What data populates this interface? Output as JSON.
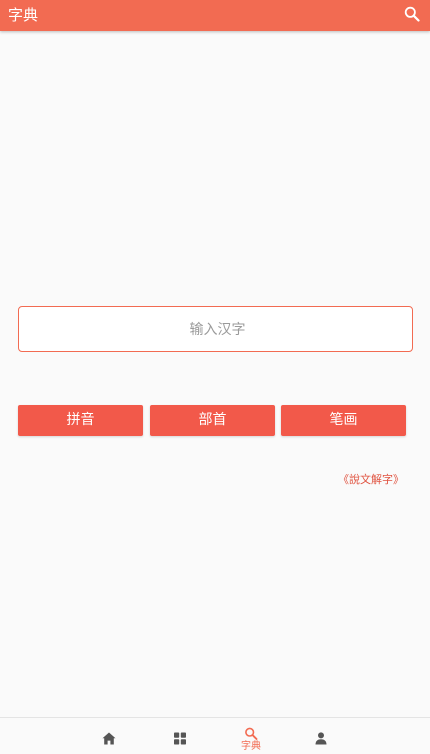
{
  "header": {
    "title": "字典",
    "search_icon": "search-icon"
  },
  "search": {
    "placeholder": "输入汉字",
    "value": ""
  },
  "buttons": {
    "pinyin": "拼音",
    "bushou": "部首",
    "bihua": "笔画"
  },
  "links": {
    "shuowen": "《說文解字》"
  },
  "tabbar": {
    "items": [
      {
        "icon": "home-icon",
        "label": ""
      },
      {
        "icon": "grid-icon",
        "label": ""
      },
      {
        "icon": "search-icon",
        "label": "字典",
        "active": true
      },
      {
        "icon": "user-icon",
        "label": ""
      }
    ]
  },
  "colors": {
    "accent": "#f26b52",
    "button": "#f2594a",
    "icon_inactive": "#555555"
  }
}
